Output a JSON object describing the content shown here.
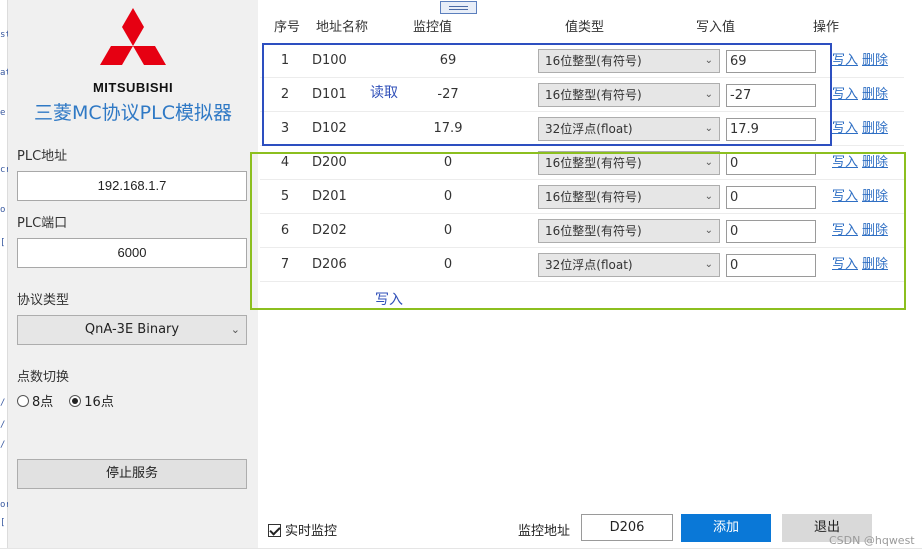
{
  "app": {
    "brand": "MITSUBISHI",
    "title": "三菱MC协议PLC模拟器"
  },
  "sidebar": {
    "plc_address_label": "PLC地址",
    "plc_address_value": "192.168.1.7",
    "plc_port_label": "PLC端口",
    "plc_port_value": "6000",
    "protocol_label": "协议类型",
    "protocol_value": "QnA-3E Binary",
    "points_label": "点数切换",
    "points_options": [
      "8点",
      "16点"
    ],
    "points_selected": "16点",
    "stop_button": "停止服务"
  },
  "table": {
    "headers": [
      "序号",
      "地址名称",
      "监控值",
      "值类型",
      "写入值",
      "操作"
    ],
    "write_label": "写入",
    "delete_label": "删除",
    "rows": [
      {
        "index": "1",
        "address": "D100",
        "monitor": "69",
        "type": "16位整型(有符号)",
        "value": "69"
      },
      {
        "index": "2",
        "address": "D101",
        "monitor": "-27",
        "type": "16位整型(有符号)",
        "value": "-27"
      },
      {
        "index": "3",
        "address": "D102",
        "monitor": "17.9",
        "type": "32位浮点(float)",
        "value": "17.9"
      },
      {
        "index": "4",
        "address": "D200",
        "monitor": "0",
        "type": "16位整型(有符号)",
        "value": "0"
      },
      {
        "index": "5",
        "address": "D201",
        "monitor": "0",
        "type": "16位整型(有符号)",
        "value": "0"
      },
      {
        "index": "6",
        "address": "D202",
        "monitor": "0",
        "type": "16位整型(有符号)",
        "value": "0"
      },
      {
        "index": "7",
        "address": "D206",
        "monitor": "0",
        "type": "32位浮点(float)",
        "value": "0"
      }
    ]
  },
  "annotations": {
    "read": "读取",
    "write": "写入"
  },
  "footer": {
    "realtime_label": "实时监控",
    "realtime_checked": true,
    "monitor_address_label": "监控地址",
    "monitor_address_value": "D206",
    "add_button": "添加",
    "exit_button": "退出"
  },
  "watermark": "CSDN @hqwest",
  "colors": {
    "read_box": "#2d4fc0",
    "write_box": "#8cbf1f",
    "add_button": "#0a78d7",
    "title_blue": "#2f79c5",
    "brand_red": "#e60012"
  }
}
